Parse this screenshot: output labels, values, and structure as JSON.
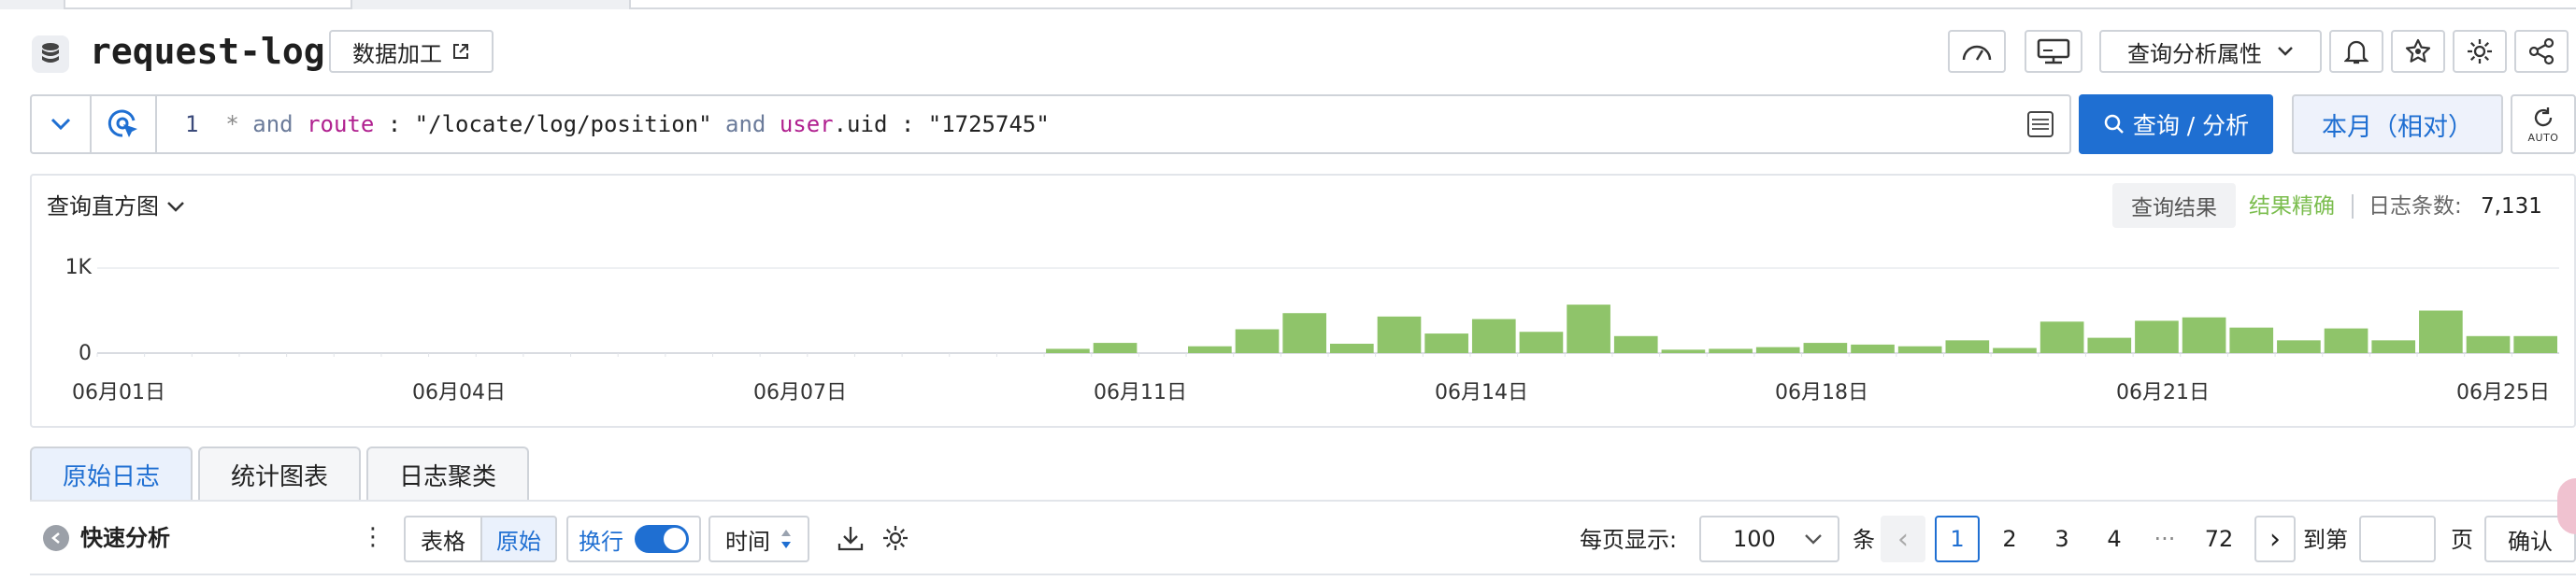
{
  "header": {
    "logstore_name": "request-log",
    "data_process_label": "数据加工",
    "query_attr_label": "查询分析属性"
  },
  "query": {
    "line_number": "1",
    "tokens": [
      {
        "text": "*",
        "kind": "op"
      },
      {
        "text": " and ",
        "kind": "kw"
      },
      {
        "text": "route",
        "kind": "field"
      },
      {
        "text": " : ",
        "kind": "str"
      },
      {
        "text": "\"/locate/log/position\"",
        "kind": "str"
      },
      {
        "text": " and ",
        "kind": "kw"
      },
      {
        "text": "user",
        "kind": "field"
      },
      {
        "text": ".uid : \"1725745\"",
        "kind": "str"
      }
    ],
    "search_label": "查询 / 分析",
    "time_range_label": "本月（相对）",
    "refresh_label": "AUTO"
  },
  "histogram": {
    "title": "查询直方图",
    "result_badge": "查询结果",
    "exact_label": "结果精确",
    "count_label": "日志条数:",
    "count_value": "7,131",
    "y_ticks": [
      "1K",
      "0"
    ],
    "x_ticks": [
      "06月01日",
      "06月04日",
      "06月07日",
      "06月11日",
      "06月14日",
      "06月18日",
      "06月21日",
      "06月25日"
    ],
    "bar_color": "#8fc46a"
  },
  "chart_data": {
    "type": "bar",
    "title": "查询直方图",
    "ylim": [
      0,
      1000
    ],
    "values": [
      0,
      0,
      0,
      0,
      0,
      0,
      0,
      0,
      0,
      0,
      0,
      0,
      0,
      0,
      0,
      0,
      0,
      0,
      0,
      0,
      50,
      120,
      0,
      80,
      280,
      470,
      110,
      430,
      230,
      400,
      250,
      570,
      200,
      40,
      50,
      70,
      120,
      100,
      80,
      150,
      60,
      370,
      180,
      380,
      420,
      300,
      150,
      290,
      150,
      500,
      200,
      200
    ]
  },
  "result_tabs": [
    {
      "label": "原始日志",
      "active": true
    },
    {
      "label": "统计图表",
      "active": false
    },
    {
      "label": "日志聚类",
      "active": false
    }
  ],
  "toolbar": {
    "quick_analysis_label": "快速分析",
    "table_label": "表格",
    "raw_label": "原始",
    "wrap_label": "换行",
    "time_label": "时间",
    "per_page_label": "每页显示:",
    "per_page_value": "100",
    "per_page_unit": "条",
    "pages": [
      "1",
      "2",
      "3",
      "4",
      "···",
      "72"
    ],
    "current_page": "1",
    "goto_label": "到第",
    "goto_unit": "页",
    "confirm_label": "确认"
  },
  "colors": {
    "primary": "#1f6fd2",
    "exact_green": "#7bbd4e",
    "field_magenta": "#b0208f"
  }
}
